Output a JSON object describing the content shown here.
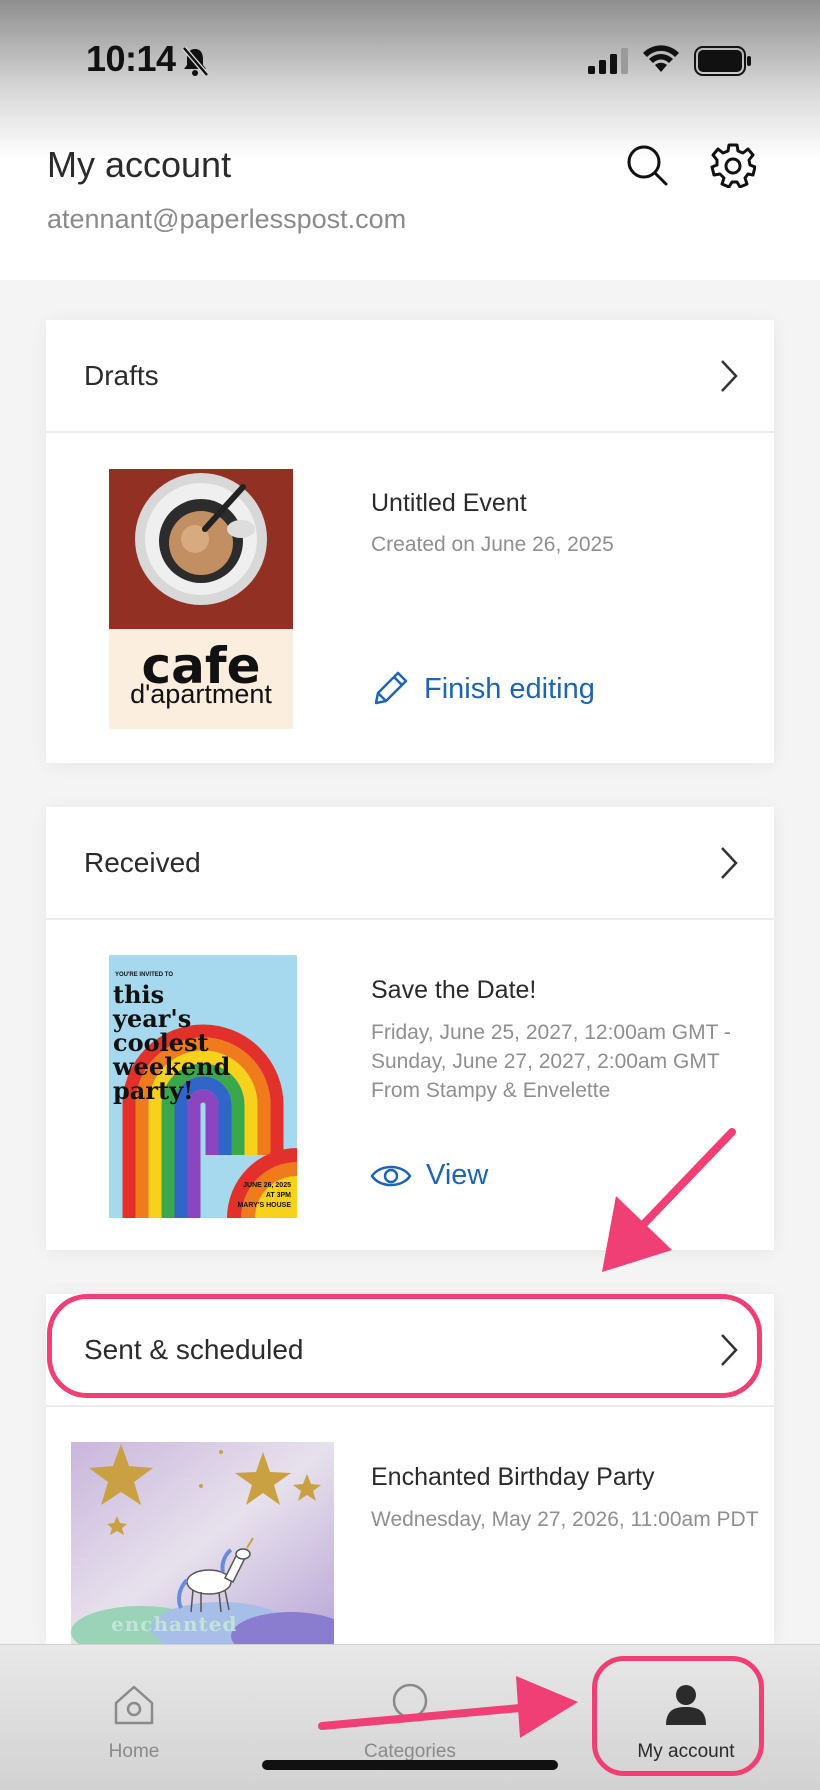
{
  "status_bar": {
    "time": "10:14"
  },
  "header": {
    "title": "My account",
    "email": "atennant@paperlesspost.com"
  },
  "drafts": {
    "title": "Drafts",
    "item": {
      "title": "Untitled Event",
      "meta": "Created on June 26, 2025",
      "action_label": "Finish editing",
      "thumb_text_main": "cafe",
      "thumb_text_sub": "d'apartment"
    }
  },
  "received": {
    "title": "Received",
    "item": {
      "title": "Save the Date!",
      "meta_line1": "Friday, June 25, 2027, 12:00am GMT -",
      "meta_line2": "Sunday, June 27, 2027, 2:00am GMT",
      "meta_line3": "From Stampy & Envelette",
      "action_label": "View",
      "thumb_kicker": "YOU'RE INVITED TO",
      "thumb_line1": "this",
      "thumb_line2": "year's",
      "thumb_line3": "coolest",
      "thumb_line4": "weekend",
      "thumb_line5": "party!",
      "thumb_date": "JUNE 26, 2025",
      "thumb_time": "AT 3PM",
      "thumb_place": "MARY'S HOUSE"
    }
  },
  "sent": {
    "title": "Sent & scheduled",
    "item": {
      "title": "Enchanted Birthday Party",
      "meta": "Wednesday, May 27, 2026, 11:00am PDT",
      "thumb_text": "enchanted"
    }
  },
  "tabs": [
    {
      "label": "Home",
      "icon": "home-icon"
    },
    {
      "label": "Categories",
      "icon": "search-icon"
    },
    {
      "label": "My account",
      "icon": "person-icon"
    }
  ],
  "colors": {
    "accent": "#1f64b4",
    "highlight": "#ef3f74"
  }
}
